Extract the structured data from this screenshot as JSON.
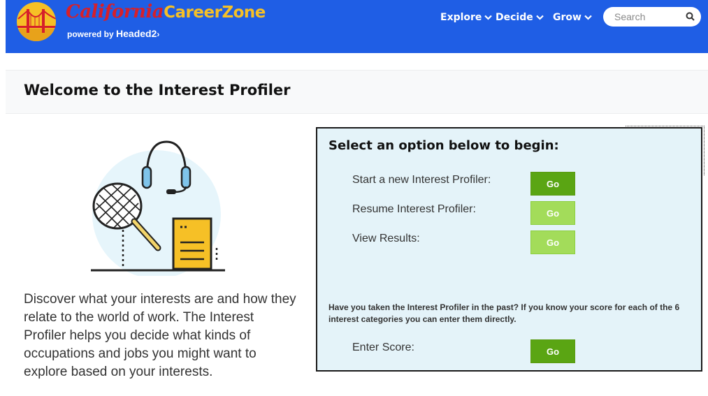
{
  "header": {
    "brand_script": "California",
    "brand_main": "CareerZone",
    "tagline_prefix": "powered by",
    "tagline_brand": "Headed2",
    "tagline_arrow": "›",
    "nav": [
      {
        "label": "Explore"
      },
      {
        "label": "Decide"
      },
      {
        "label": "Grow"
      }
    ],
    "search_placeholder": "Search"
  },
  "page": {
    "title": "Welcome to the Interest Profiler"
  },
  "description": "Discover what your interests are and how they relate to the world of work. The Interest Profiler helps you decide what kinds of occupations and jobs you might want to explore based on your interests.",
  "panel": {
    "heading": "Select an option below to begin:",
    "options": [
      {
        "label": "Start a new Interest Profiler:",
        "button": "Go",
        "state": "enabled"
      },
      {
        "label": "Resume Interest Profiler:",
        "button": "Go",
        "state": "disabled"
      },
      {
        "label": "View Results:",
        "button": "Go",
        "state": "disabled"
      }
    ],
    "past_note": "Have you taken the Interest Profiler in the past? If you know your score for each of the 6 interest categories you can enter them directly.",
    "enter_score": {
      "label": "Enter Score:",
      "button": "Go",
      "state": "enabled"
    }
  },
  "colors": {
    "header_bg": "#1f5ee5",
    "brand_red": "#d6202a",
    "brand_gold": "#f6c026",
    "go_enabled": "#5aa513",
    "go_disabled": "#a3dc5a",
    "panel_bg": "#e4f3f9"
  },
  "icons": [
    "golden-gate-logo-icon",
    "chevron-down-icon",
    "search-icon",
    "headset-icon",
    "tennis-racket-icon",
    "document-icon"
  ]
}
